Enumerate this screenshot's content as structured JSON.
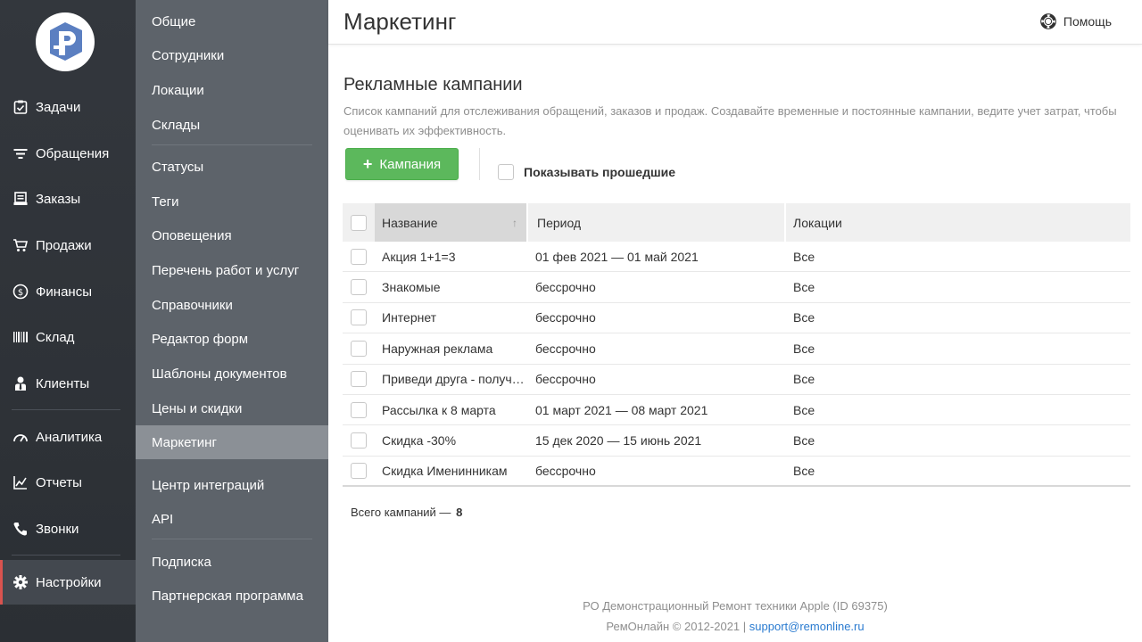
{
  "brand": {
    "logo_name": "remonline-logo",
    "accent": "#5b7fc1"
  },
  "nav_primary": [
    {
      "label": "Задачи",
      "icon": "tasks-icon"
    },
    {
      "label": "Обращения",
      "icon": "filter-icon"
    },
    {
      "label": "Заказы",
      "icon": "orders-icon"
    },
    {
      "label": "Продажи",
      "icon": "cart-icon"
    },
    {
      "label": "Финансы",
      "icon": "dollar-icon"
    },
    {
      "label": "Склад",
      "icon": "barcode-icon"
    },
    {
      "label": "Клиенты",
      "icon": "client-icon"
    },
    {
      "label": "Аналитика",
      "icon": "gauge-icon"
    },
    {
      "label": "Отчеты",
      "icon": "chart-icon"
    },
    {
      "label": "Звонки",
      "icon": "phone-icon"
    },
    {
      "label": "Настройки",
      "icon": "gear-icon"
    }
  ],
  "nav_secondary": [
    "Общие",
    "Сотрудники",
    "Локации",
    "Склады",
    "Статусы",
    "Теги",
    "Оповещения",
    "Перечень работ и услуг",
    "Справочники",
    "Редактор форм",
    "Шаблоны документов",
    "Цены и скидки",
    "Маркетинг",
    "Центр интеграций",
    "API",
    "Подписка",
    "Партнерская программа"
  ],
  "header": {
    "title": "Маркетинг",
    "help_label": "Помощь"
  },
  "section": {
    "title": "Рекламные кампании",
    "description": "Список кампаний для отслеживания обращений, заказов и продаж. Создавайте временные и постоянные кампании, ведите учет затрат, чтобы оценивать их эффективность."
  },
  "toolbar": {
    "add_label": "Кампания",
    "show_past_label": "Показывать прошедшие"
  },
  "table": {
    "columns": [
      "Название",
      "Период",
      "Локации"
    ],
    "rows": [
      {
        "name": "Акция 1+1=3",
        "period": "01 фев 2021 — 01 май 2021",
        "locations": "Все"
      },
      {
        "name": "Знакомые",
        "period": "бессрочно",
        "locations": "Все"
      },
      {
        "name": "Интернет",
        "period": "бессрочно",
        "locations": "Все"
      },
      {
        "name": "Наружная реклама",
        "period": "бессрочно",
        "locations": "Все"
      },
      {
        "name": "Приведи друга - получ…",
        "period": "бессрочно",
        "locations": "Все"
      },
      {
        "name": "Рассылка к 8 марта",
        "period": "01 март 2021 — 08 март 2021",
        "locations": "Все"
      },
      {
        "name": "Скидка -30%",
        "period": "15 дек 2020 — 15 июнь 2021",
        "locations": "Все"
      },
      {
        "name": "Скидка Именинникам",
        "period": "бессрочно",
        "locations": "Все"
      }
    ]
  },
  "summary": {
    "label": "Всего кампаний —",
    "count": "8"
  },
  "footer": {
    "line1": "РО Демонстрационный Ремонт техники Apple (ID 69375)",
    "line2": "РемОнлайн © 2012-2021 |",
    "email": "support@remonline.ru"
  },
  "colors": {
    "primary_nav_bg": "#2f3338",
    "secondary_nav_bg": "#5d636a",
    "active_sub": "#8b9096",
    "button_green": "#5cb85c",
    "active_marker": "#d9534f",
    "link": "#2a7bd0"
  }
}
